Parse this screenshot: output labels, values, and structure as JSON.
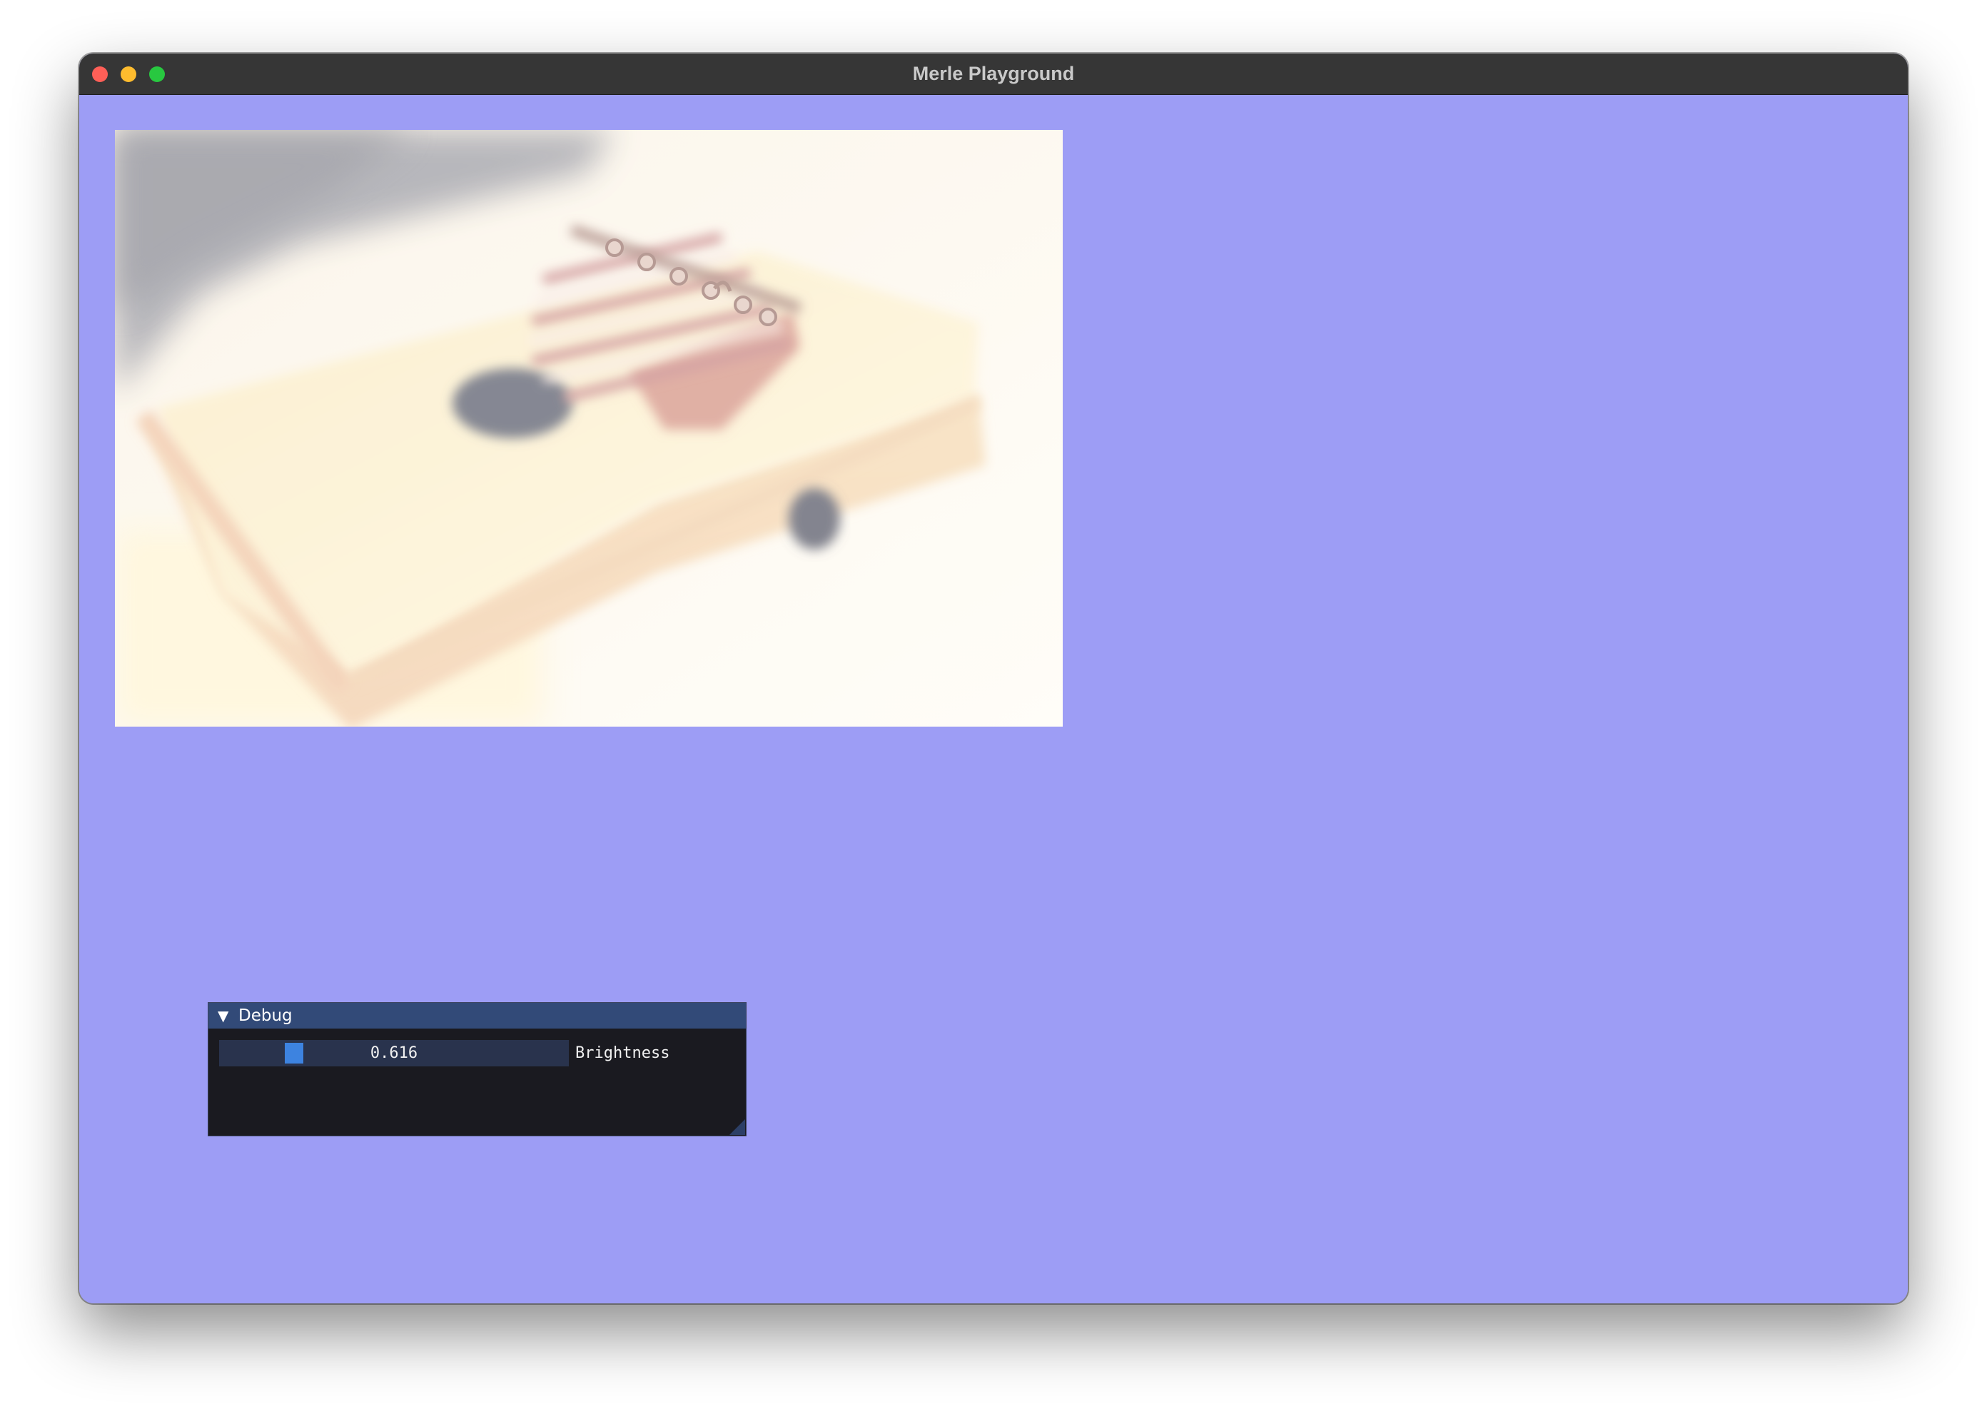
{
  "window": {
    "title": "Merle Playground"
  },
  "titlebar_buttons": [
    {
      "name": "close",
      "color": "#ff5f57"
    },
    {
      "name": "minimize",
      "color": "#febc2e"
    },
    {
      "name": "zoom",
      "color": "#28c840"
    }
  ],
  "colors": {
    "canvas_background": "#9d9df5",
    "debug_titlebar": "#324a78",
    "debug_background": "#1a1a20",
    "slider_accent": "#3d83e0"
  },
  "image": {
    "subject": "kalimba (thumb piano) photo, brightened"
  },
  "debug": {
    "collapse_icon": "triangle-down-icon",
    "title": "Debug",
    "brightness": {
      "value": 0.616,
      "value_text": "0.616",
      "label": "Brightness"
    }
  }
}
